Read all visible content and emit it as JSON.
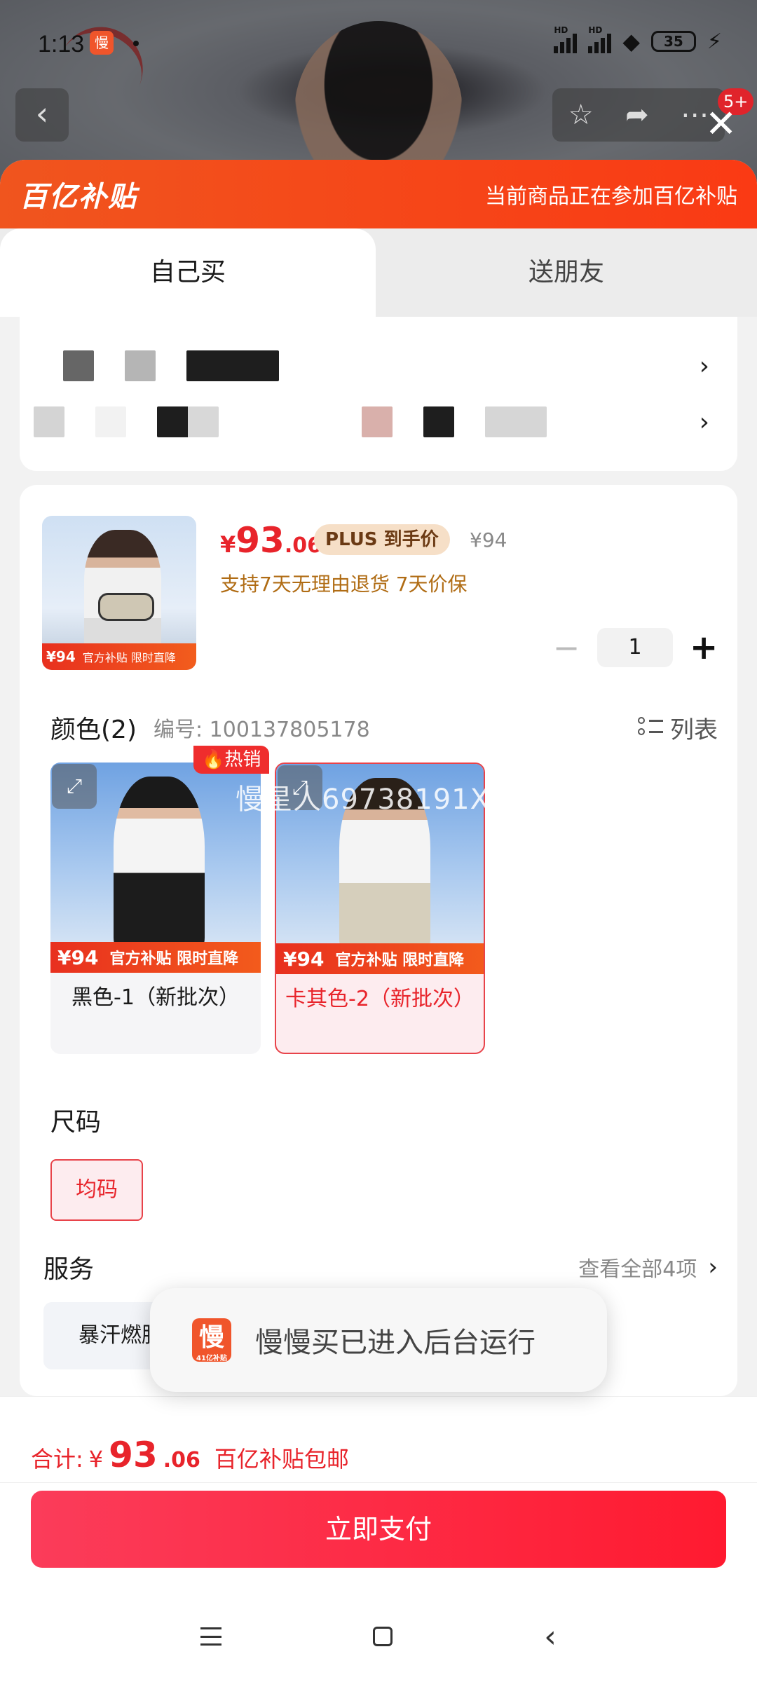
{
  "status_bar": {
    "time": "1:13",
    "app_badge": "慢",
    "signal_label_1": "HD",
    "signal_label_2": "HD",
    "battery": "35"
  },
  "top_nav": {
    "back_glyph": "‹",
    "badge_count": "5+",
    "close_glyph": "✕"
  },
  "banner": {
    "brand": "百亿补贴",
    "note": "当前商品正在参加百亿补贴"
  },
  "tabs": [
    {
      "label": "自己买"
    },
    {
      "label": "送朋友"
    }
  ],
  "product": {
    "price_currency": "¥",
    "price_int": "93",
    "price_dec": ".06",
    "plus_tag": "PLUS 到手价",
    "original_price": "¥94",
    "return_note": "支持7天无理由退货  7天价保",
    "thumb_price": "94",
    "thumb_promo": "官方补贴  限时直降",
    "quantity": "1",
    "minus_glyph": "−",
    "plus_glyph": "+"
  },
  "color": {
    "title": "颜色(2)",
    "code": "编号: 100137805178",
    "list_label": "列表",
    "hot_badge": "热销",
    "watermark": "慢星人69738191X",
    "options": [
      {
        "label": "黑色-1（新批次）",
        "price": "94",
        "promo": "官方补贴  限时直降",
        "selected": false
      },
      {
        "label": "卡其色-2（新批次）",
        "price": "94",
        "promo": "官方补贴  限时直降",
        "selected": true
      }
    ]
  },
  "size": {
    "title": "尺码",
    "options": [
      "均码"
    ]
  },
  "service": {
    "title": "服务",
    "more": "查看全部4项",
    "chip": "暴汗燃脂"
  },
  "toast": {
    "icon_text": "慢",
    "icon_sub": "41亿补贴",
    "message": "慢慢买已进入后台运行"
  },
  "checkout": {
    "total_label": "合计:",
    "currency": "¥",
    "total_int": "93",
    "total_dec": ".06",
    "shipping_note": "百亿补贴包邮",
    "pay_button": "立即支付"
  },
  "colors": {
    "accent": "#e8242b",
    "banner": "#f0551e",
    "pay_button": "#ff1a30"
  }
}
